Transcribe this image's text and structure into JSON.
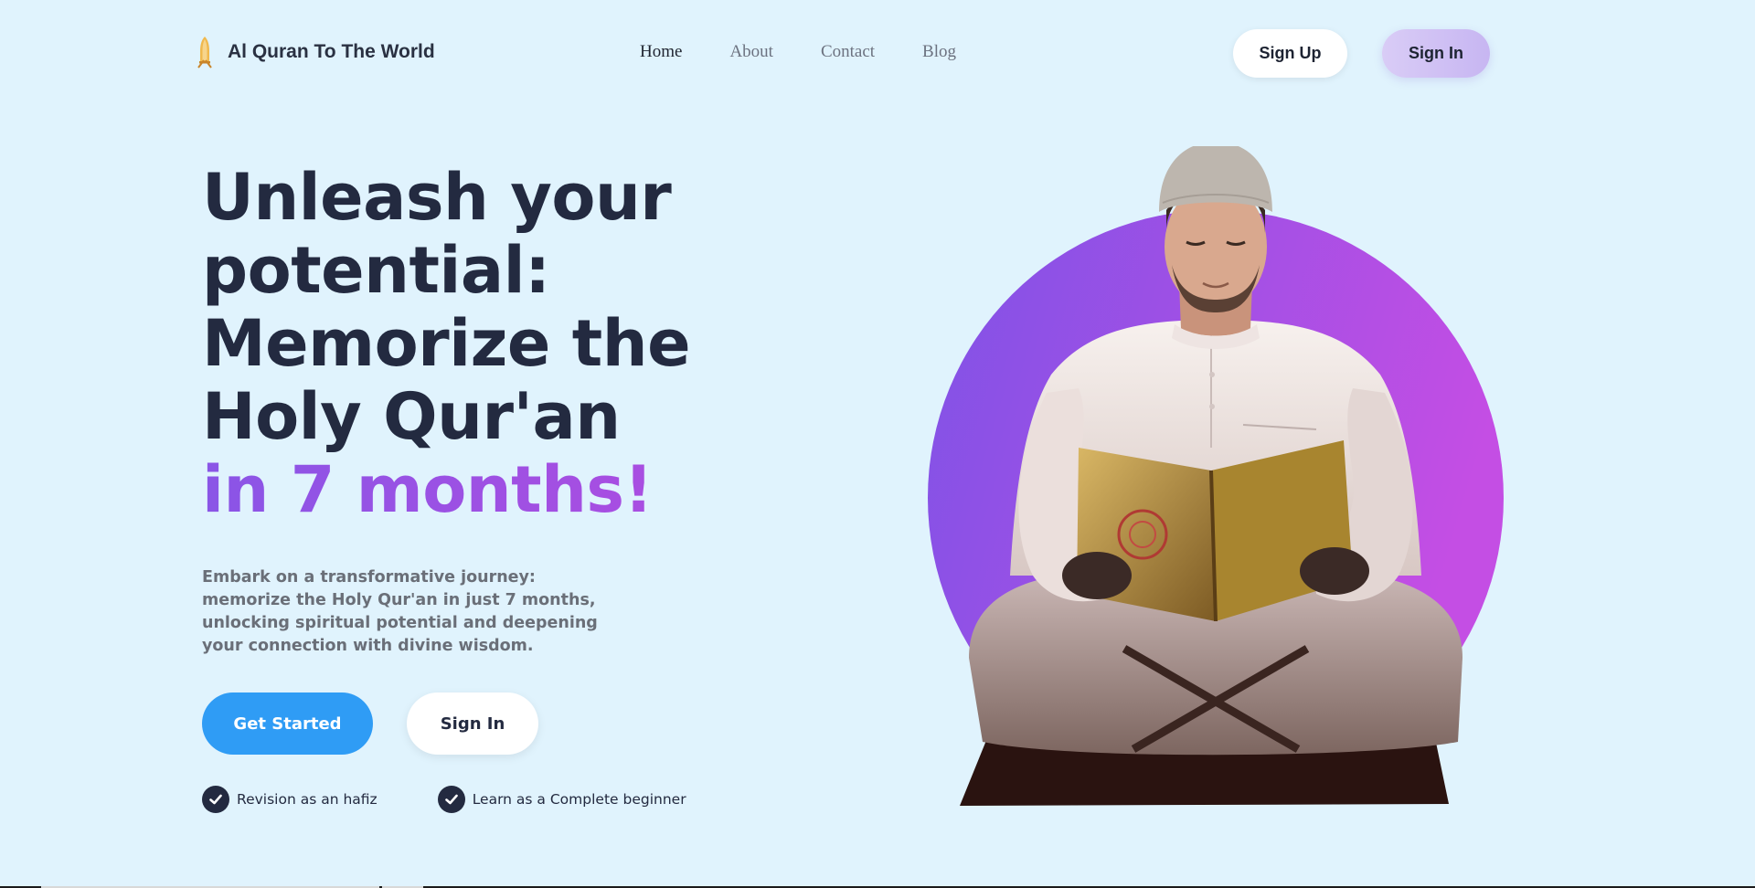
{
  "brand": {
    "name": "Al Quran To The World",
    "logo_icon": "quran-stand-icon"
  },
  "nav": {
    "links": [
      {
        "label": "Home",
        "active": true
      },
      {
        "label": "About",
        "active": false
      },
      {
        "label": "Contact",
        "active": false
      },
      {
        "label": "Blog",
        "active": false
      }
    ],
    "signup_label": "Sign Up",
    "signin_label": "Sign In"
  },
  "hero": {
    "headline_lines": [
      "Unleash your",
      "potential:",
      "Memorize the",
      "Holy Qur'an"
    ],
    "headline_accent": "in 7 months!",
    "subtext": "Embark on a transformative journey: memorize the Holy Qur'an in just 7 months, unlocking spiritual potential and deepening your connection with divine wisdom.",
    "primary_cta": "Get Started",
    "secondary_cta": "Sign In",
    "features": [
      {
        "label": "Revision as an hafiz",
        "icon": "check-circle-icon"
      },
      {
        "label": "Learn as a Complete beginner",
        "icon": "check-circle-icon"
      }
    ]
  },
  "colors": {
    "background": "#e0f3fd",
    "heading": "#232a40",
    "accent_gradient_start": "#8a55e6",
    "accent_gradient_end": "#b14ce0",
    "primary_button": "#2f9cf5",
    "circle_start": "#7f52e6",
    "circle_end": "#c44ee4"
  }
}
